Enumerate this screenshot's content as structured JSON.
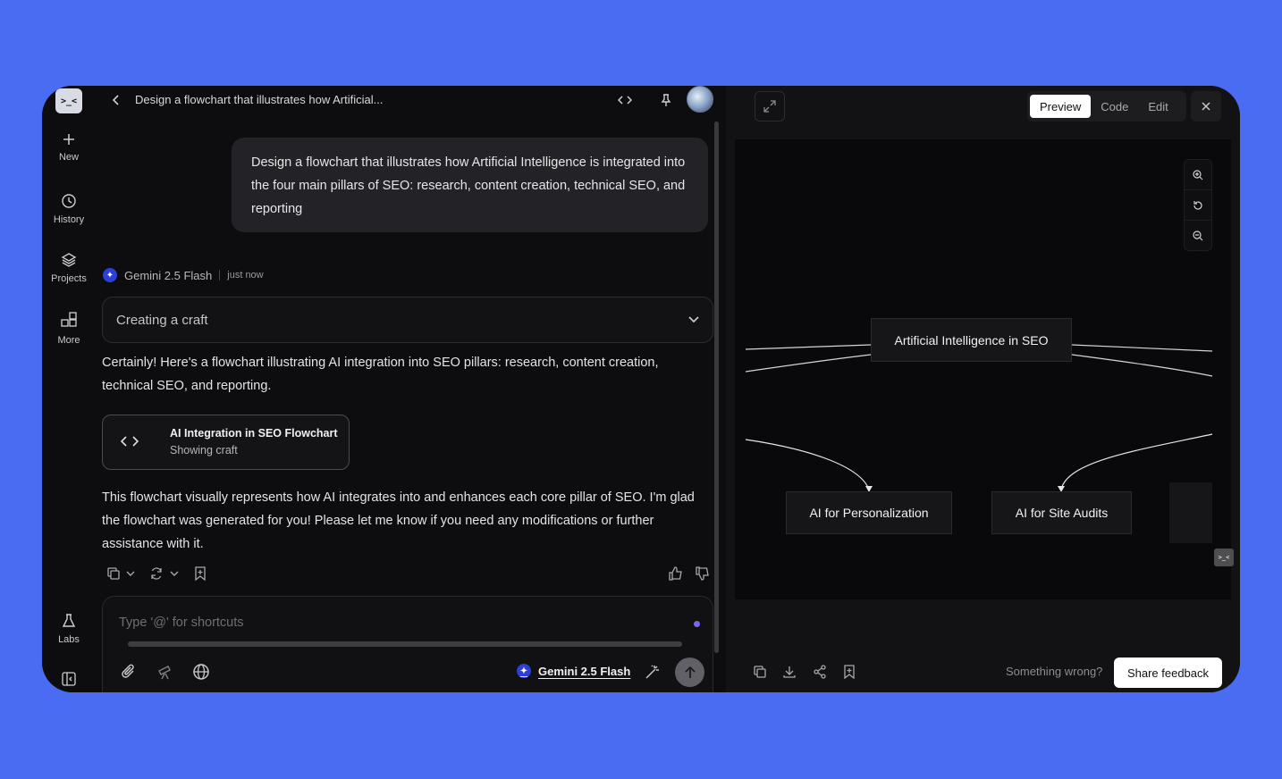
{
  "app": {
    "logo_text": ">_<"
  },
  "sidebar": {
    "items": [
      {
        "label": "New",
        "icon": "plus-icon"
      },
      {
        "label": "History",
        "icon": "history-icon"
      },
      {
        "label": "Projects",
        "icon": "layers-icon"
      },
      {
        "label": "More",
        "icon": "grid-plus-icon"
      },
      {
        "label": "Labs",
        "icon": "flask-icon"
      }
    ],
    "collapse_icon": "sidebar-collapse-icon"
  },
  "header": {
    "title": "Design a flowchart that illustrates how Artificial...",
    "icons": [
      "code-icon",
      "pin-icon",
      "share-icon",
      "avatar"
    ]
  },
  "conversation": {
    "prompt": "Design a flowchart that illustrates how Artificial Intelligence is integrated into the four main pillars of SEO: research, content creation, technical SEO, and reporting",
    "model_name": "Gemini 2.5 Flash",
    "timestamp": "just now",
    "craft_status": "Creating a craft",
    "intro": "Certainly! Here's a flowchart illustrating AI integration into SEO pillars: research, content creation, technical SEO, and reporting.",
    "artifact": {
      "title": "AI Integration in SEO Flowchart",
      "subtitle": "Showing craft"
    },
    "outro": "This flowchart visually represents how AI integrates into and enhances each core pillar of SEO. I'm glad the flowchart was generated for you! Please let me know if you need any modifications or further assistance with it."
  },
  "composer": {
    "placeholder": "Type '@' for shortcuts",
    "model_name": "Gemini 2.5 Flash"
  },
  "preview": {
    "tabs": [
      "Preview",
      "Code",
      "Edit"
    ],
    "active_tab": "Preview",
    "flowchart": {
      "root": "Artificial Intelligence in SEO",
      "children": [
        "AI for Personalization",
        "AI for Site Audits"
      ],
      "mini_logo": ">_<"
    },
    "footer_prompt": "Something wrong?",
    "feedback_label": "Share feedback"
  },
  "colors": {
    "background": "#4a6cf2",
    "window": "#0d0d0f",
    "accent": "#2c3fd6"
  }
}
